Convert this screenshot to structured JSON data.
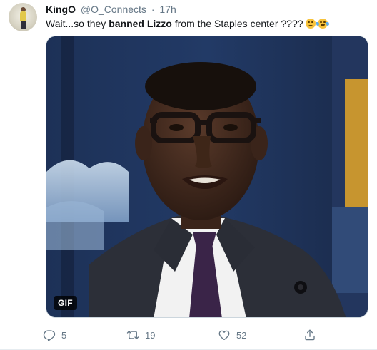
{
  "tweet": {
    "author_name": "KingO",
    "author_handle": "@O_Connects",
    "separator": "·",
    "timestamp": "17h",
    "text_before": "Wait...so they ",
    "text_bold": "banned Lizzo",
    "text_after": " from the Staples center ????",
    "emojis": [
      "pleading-face",
      "face-with-tears-of-joy"
    ]
  },
  "media": {
    "badge": "GIF"
  },
  "actions": {
    "reply_count": "5",
    "retweet_count": "19",
    "like_count": "52"
  },
  "icons": {
    "reply": "reply-icon",
    "retweet": "retweet-icon",
    "like": "heart-icon",
    "share": "share-icon"
  },
  "colors": {
    "text_primary": "#14171a",
    "text_secondary": "#657786",
    "border": "#e6ecf0"
  }
}
